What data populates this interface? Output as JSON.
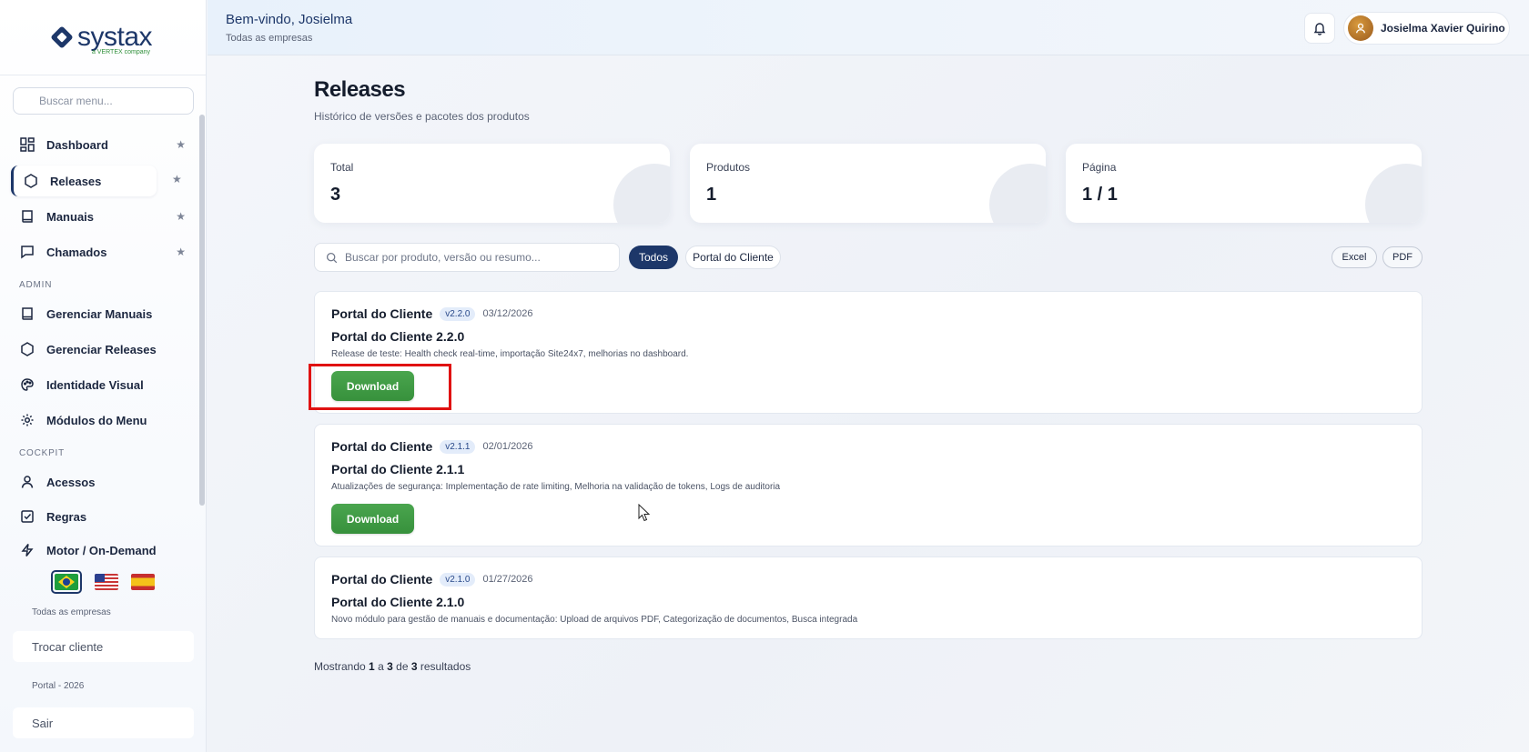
{
  "logo": {
    "name": "systax",
    "tagline": "a VERTEX company"
  },
  "sidebar": {
    "search_placeholder": "Buscar menu...",
    "items": [
      {
        "label": "Dashboard",
        "icon": "dashboard-grid-icon",
        "starred": true
      },
      {
        "label": "Releases",
        "icon": "hexagon-icon",
        "starred": true,
        "active": true
      },
      {
        "label": "Manuais",
        "icon": "book-icon",
        "starred": true
      },
      {
        "label": "Chamados",
        "icon": "chat-bubble-icon",
        "starred": true
      }
    ],
    "admin_label": "ADMIN",
    "admin_items": [
      {
        "label": "Gerenciar Manuais",
        "icon": "book-icon"
      },
      {
        "label": "Gerenciar Releases",
        "icon": "hexagon-icon"
      },
      {
        "label": "Identidade Visual",
        "icon": "palette-icon"
      },
      {
        "label": "Módulos do Menu",
        "icon": "gear-icon"
      }
    ],
    "cockpit_label": "COCKPIT",
    "cockpit_items": [
      {
        "label": "Acessos",
        "icon": "user-icon"
      },
      {
        "label": "Regras",
        "icon": "checkbox-icon"
      },
      {
        "label": "Motor / On-Demand",
        "icon": "lightning-icon"
      }
    ],
    "languages": [
      "pt-BR",
      "en-US",
      "es-ES"
    ],
    "company_scope": "Todas as empresas",
    "switch_client": "Trocar cliente",
    "portal_label": "Portal - 2026",
    "logout": "Sair"
  },
  "header": {
    "welcome": "Bem-vindo, Josielma",
    "scope": "Todas as empresas",
    "user_name": "Josielma Xavier Quirino"
  },
  "page": {
    "title": "Releases",
    "subtitle": "Histórico de versões e pacotes dos produtos"
  },
  "stats": [
    {
      "label": "Total",
      "value": "3"
    },
    {
      "label": "Produtos",
      "value": "1"
    },
    {
      "label": "Página",
      "value": "1 / 1"
    }
  ],
  "filters": {
    "search_placeholder": "Buscar por produto, versão ou resumo...",
    "chips": [
      "Todos",
      "Portal do Cliente"
    ],
    "export_excel": "Excel",
    "export_pdf": "PDF"
  },
  "releases": [
    {
      "product": "Portal do Cliente",
      "version": "v2.2.0",
      "date": "03/12/2026",
      "title": "Portal do Cliente 2.2.0",
      "description": "Release de teste: Health check real-time, importação Site24x7, melhorias no dashboard.",
      "download": "Download"
    },
    {
      "product": "Portal do Cliente",
      "version": "v2.1.1",
      "date": "02/01/2026",
      "title": "Portal do Cliente 2.1.1",
      "description": "Atualizações de segurança: Implementação de rate limiting, Melhoria na validação de tokens, Logs de auditoria",
      "download": "Download"
    },
    {
      "product": "Portal do Cliente",
      "version": "v2.1.0",
      "date": "01/27/2026",
      "title": "Portal do Cliente 2.1.0",
      "description": "Novo módulo para gestão de manuais e documentação: Upload de arquivos PDF, Categorização de documentos, Busca integrada"
    }
  ],
  "pagination": {
    "prefix": "Mostrando",
    "from": "1",
    "sep1": "a",
    "to": "3",
    "sep2": "de",
    "total": "3",
    "suffix": "resultados"
  },
  "colors": {
    "brand": "#1d3769",
    "download_green": "#3f9c44",
    "highlight_red": "#e01212"
  }
}
